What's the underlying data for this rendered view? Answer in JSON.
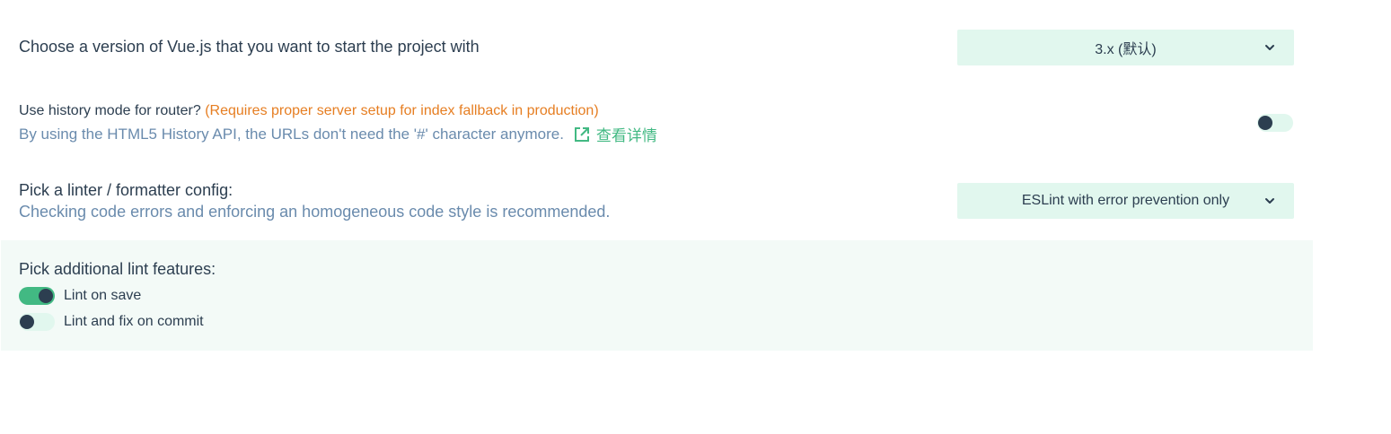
{
  "vue_version": {
    "label": "Choose a version of Vue.js that you want to start the project with",
    "selected": "3.x (默认)"
  },
  "history_mode": {
    "label": "Use history mode for router?",
    "warning": "(Requires proper server setup for index fallback in production)",
    "description": "By using the HTML5 History API, the URLs don't need the '#' character anymore.",
    "link_text": "查看详情",
    "enabled": false
  },
  "linter": {
    "label": "Pick a linter / formatter config:",
    "description": "Checking code errors and enforcing an homogeneous code style is recommended.",
    "selected": "ESLint with error prevention only"
  },
  "lint_features": {
    "label": "Pick additional lint features:",
    "items": [
      {
        "label": "Lint on save",
        "enabled": true
      },
      {
        "label": "Lint and fix on commit",
        "enabled": false
      }
    ]
  },
  "colors": {
    "accent": "#42b983",
    "warning": "#e67e22",
    "muted": "#6a8bad",
    "select_bg": "#e1f7ee",
    "panel_bg": "#f3faf7"
  },
  "icons": {
    "external_link": "external-link-icon",
    "chevron": "chevron-down-icon"
  }
}
